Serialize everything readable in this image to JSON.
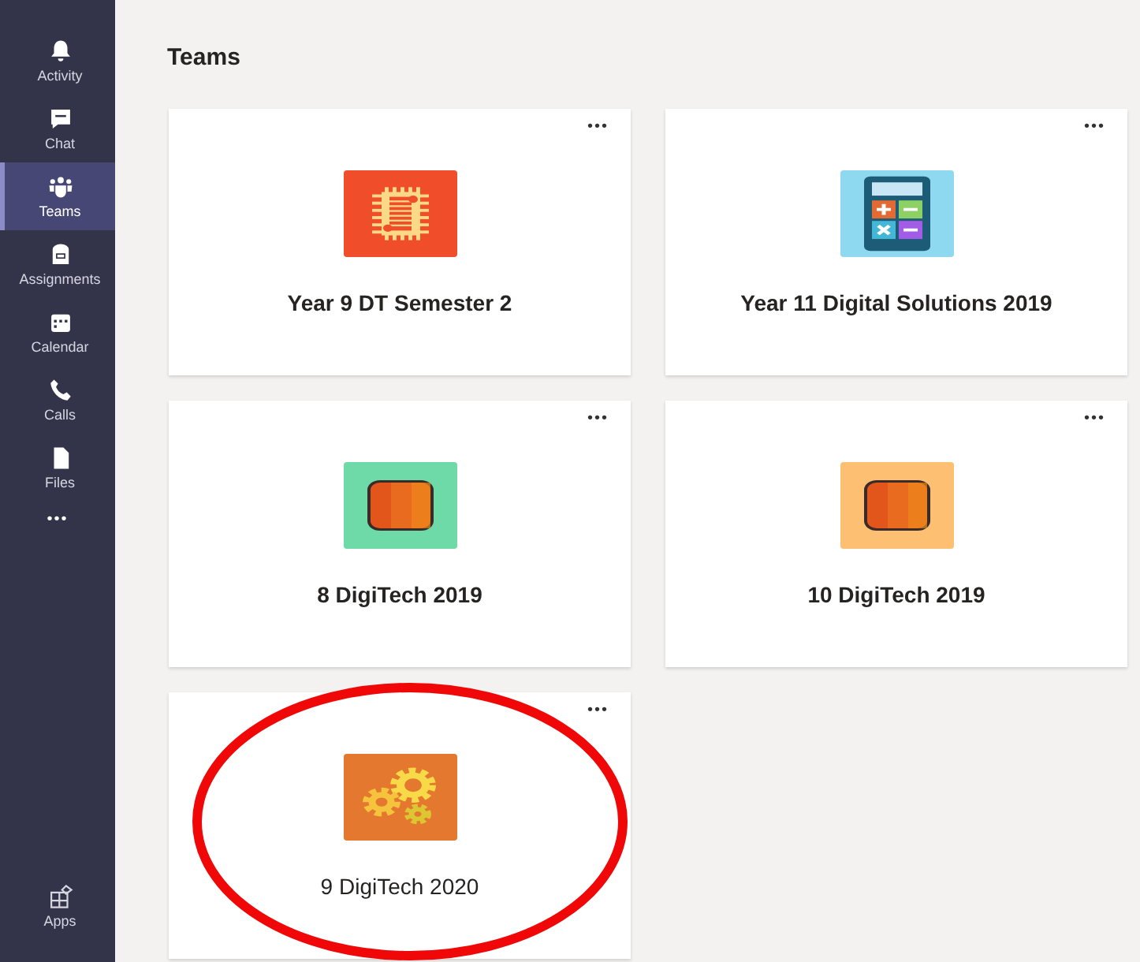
{
  "sidebar": {
    "items": [
      {
        "label": "Activity",
        "selected": false
      },
      {
        "label": "Chat",
        "selected": false
      },
      {
        "label": "Teams",
        "selected": true
      },
      {
        "label": "Assignments",
        "selected": false
      },
      {
        "label": "Calendar",
        "selected": false
      },
      {
        "label": "Calls",
        "selected": false
      },
      {
        "label": "Files",
        "selected": false
      }
    ],
    "more": "•••",
    "apps": {
      "label": "Apps"
    }
  },
  "header": {
    "title": "Teams"
  },
  "teams": [
    {
      "name": "Year 9 DT Semester 2",
      "kind": "chip",
      "color": "#f04e2a",
      "unread": true,
      "menu": "•••"
    },
    {
      "name": "Year 11 Digital Solutions 2019",
      "kind": "calculator",
      "color": "#8ed8f0",
      "unread": true,
      "menu": "•••"
    },
    {
      "name": "8 DigiTech 2019",
      "kind": "tablet",
      "color": "#6edaa8",
      "unread": true,
      "menu": "•••"
    },
    {
      "name": "10 DigiTech 2019",
      "kind": "tablet",
      "color": "#fdc073",
      "unread": true,
      "menu": "•••"
    },
    {
      "name": "9 DigiTech 2020",
      "kind": "gears",
      "color": "#e5782f",
      "unread": false,
      "menu": "•••"
    }
  ]
}
